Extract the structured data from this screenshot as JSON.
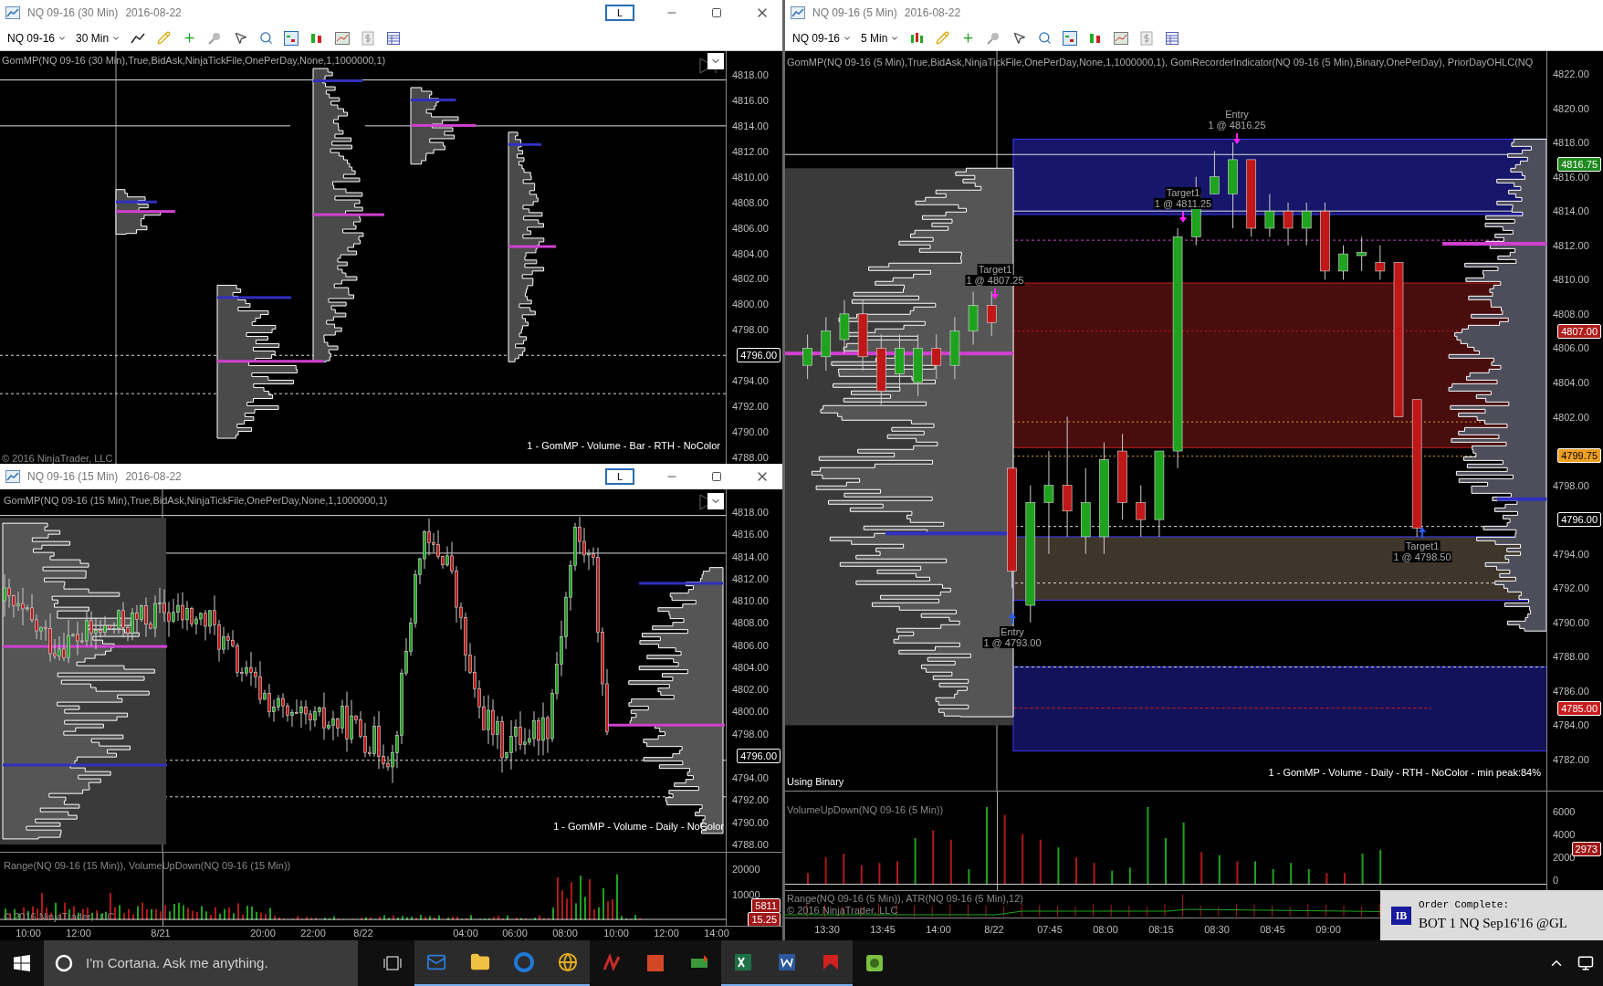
{
  "top_left_window": {
    "title": "NQ 09-16 (30 Min)",
    "date": "2016-08-22",
    "pin_button": "L",
    "toolbar": {
      "instrument": "NQ 09-16",
      "interval": "30 Min"
    },
    "indicator_label": "GomMP(NQ 09-16 (30 Min),True,BidAsk,NinjaTickFile,OnePerDay,None,1,1000000,1)",
    "price_axis": [
      "4818.00",
      "4816.00",
      "4814.00",
      "4812.00",
      "4810.00",
      "4808.00",
      "4806.00",
      "4804.00",
      "4802.00",
      "4800.00",
      "4798.00",
      "4794.00",
      "4792.00",
      "4790.00",
      "4788.00"
    ],
    "price_markers": [
      {
        "text": "4796.00",
        "color": "#000000"
      }
    ],
    "footer_label": "1 - GomMP - Volume - Bar - RTH - NoColor",
    "copyright": "© 2016 NinjaTrader, LLC"
  },
  "bottom_left_window": {
    "title": "NQ 09-16 (15 Min)",
    "date": "2016-08-22",
    "pin_button": "L",
    "indicator_label": "GomMP(NQ 09-16 (15 Min),True,BidAsk,NinjaTickFile,OnePerDay,None,1,1000000,1)",
    "price_axis": [
      "4818.00",
      "4816.00",
      "4814.00",
      "4812.00",
      "4810.00",
      "4808.00",
      "4806.00",
      "4804.00",
      "4802.00",
      "4800.00",
      "4798.00",
      "4794.00",
      "4792.00",
      "4790.00",
      "4788.00"
    ],
    "price_markers": [
      {
        "text": "4796.00",
        "color": "#000000"
      }
    ],
    "footer_label": "1 - GomMP - Volume - Daily - NoColor",
    "lower_panel": {
      "label": "Range(NQ 09-16 (15 Min)), VolumeUpDown(NQ 09-16 (15 Min))",
      "axis": [
        "20000",
        "10000"
      ],
      "markers": [
        {
          "text": "5811",
          "color": "#a01818"
        },
        {
          "text": "15.25",
          "color": "#a01818"
        }
      ],
      "copyright": "© 2016 NinjaTrader, LLC"
    },
    "time_axis": [
      "10:00",
      "12:00",
      "8/21",
      "20:00",
      "22:00",
      "8/22",
      "04:00",
      "06:00",
      "08:00",
      "10:00",
      "12:00",
      "14:00"
    ]
  },
  "right_window": {
    "title": "NQ 09-16 (5 Min)",
    "date": "2016-08-22",
    "toolbar": {
      "instrument": "NQ 09-16",
      "interval": "5 Min"
    },
    "indicator_label": "GomMP(NQ 09-16 (5 Min),True,BidAsk,NinjaTickFile,OnePerDay,None,1,1000000,1), GomRecorderIndicator(NQ 09-16 (5 Min),Binary,OnePerDay), PriorDayOHLC(NQ",
    "price_axis": [
      "4822.00",
      "4820.00",
      "4818.00",
      "4816.00",
      "4814.00",
      "4812.00",
      "4810.00",
      "4808.00",
      "4806.00",
      "4804.00",
      "4802.00",
      "4798.00",
      "4794.00",
      "4792.00",
      "4790.00",
      "4788.00",
      "4786.00",
      "4784.00",
      "4782.00"
    ],
    "price_markers": [
      {
        "text": "4816.75",
        "color": "#1e8a1e"
      },
      {
        "text": "4807.00",
        "color": "#b01c1c"
      },
      {
        "text": "4799.75",
        "color": "#f0a020"
      },
      {
        "text": "4796.00",
        "color": "#000000"
      },
      {
        "text": "4785.00",
        "color": "#c81c1c"
      }
    ],
    "trades": [
      {
        "label": "Entry",
        "detail": "1 @ 4816.25",
        "kind": "sell"
      },
      {
        "label": "Target1",
        "detail": "1 @ 4811.25",
        "kind": "sell"
      },
      {
        "label": "Target1",
        "detail": "1 @ 4807.25",
        "kind": "sell"
      },
      {
        "label": "Entry",
        "detail": "1 @ 4793.00",
        "kind": "buy"
      },
      {
        "label": "Target1",
        "detail": "1 @ 4798.50",
        "kind": "buy"
      }
    ],
    "status_text": "Using Binary",
    "footer_label": "1 - GomMP - Volume - Daily - RTH - NoColor - min peak:84%",
    "volume_panel": {
      "label": "VolumeUpDown(NQ 09-16 (5 Min))",
      "axis": [
        "6000",
        "4000",
        "2000",
        "0"
      ],
      "markers": [
        {
          "text": "2973",
          "color": "#a01818"
        }
      ]
    },
    "range_panel": {
      "label": "Range(NQ 09-16 (5 Min)), ATR(NQ 09-16 (5 Min),12)",
      "copyright": "© 2016 NinjaTrader, LLC"
    },
    "time_axis": [
      "13:30",
      "13:45",
      "14:00",
      "8/22",
      "07:45",
      "08:00",
      "08:15",
      "08:30",
      "08:45",
      "09:00"
    ]
  },
  "notification": {
    "logo": "IB",
    "title": "Order Complete:",
    "message": "BOT 1 NQ Sep16'16 @GL"
  },
  "taskbar": {
    "search_placeholder": "I'm Cortana. Ask me anything."
  }
}
